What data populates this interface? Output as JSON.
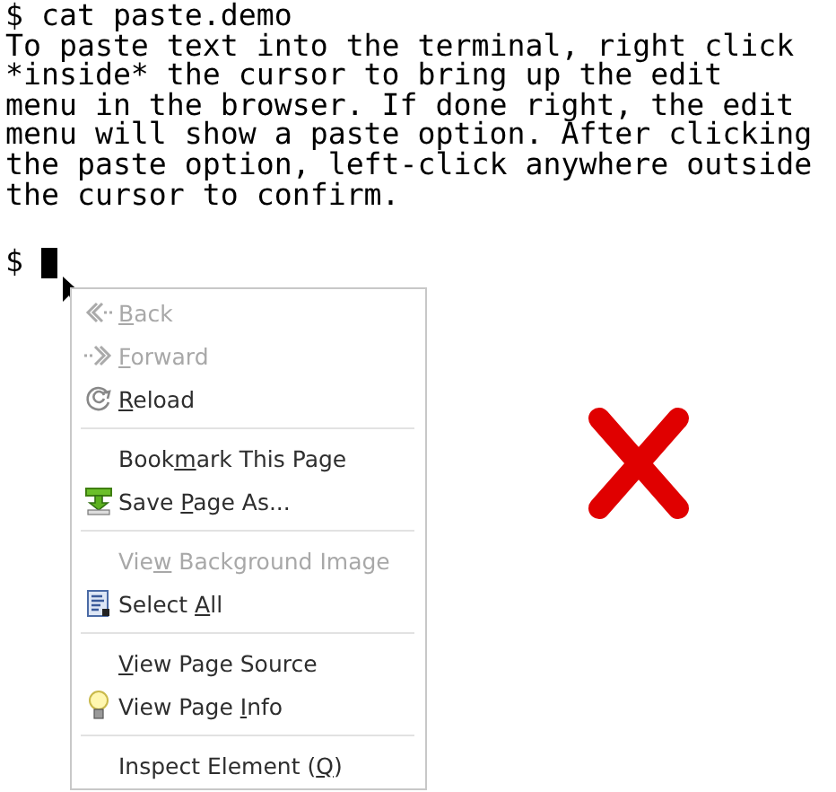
{
  "terminal": {
    "lines": [
      "$ cat paste.demo",
      "To paste text into the terminal, right click",
      "*inside* the cursor to bring up the edit",
      "menu in the browser. If done right, the edit",
      "menu will show a paste option. After clicking",
      "the paste option, left-click anywhere outside",
      "the cursor to confirm."
    ],
    "prompt": "$"
  },
  "context_menu": {
    "items": [
      {
        "kind": "item",
        "key": "B",
        "post": "ack",
        "disabled": true
      },
      {
        "kind": "item",
        "key": "F",
        "post": "orward",
        "disabled": true
      },
      {
        "kind": "item",
        "key": "R",
        "post": "eload",
        "disabled": false
      },
      {
        "kind": "separator"
      },
      {
        "kind": "item",
        "pre": "Book",
        "key": "m",
        "post": "ark This Page",
        "disabled": false
      },
      {
        "kind": "item",
        "pre": "Save ",
        "key": "P",
        "post": "age As...",
        "disabled": false
      },
      {
        "kind": "separator"
      },
      {
        "kind": "item",
        "pre": "Vie",
        "key": "w",
        "post": " Background Image",
        "disabled": true
      },
      {
        "kind": "item",
        "pre": "Select ",
        "key": "A",
        "post": "ll",
        "disabled": false
      },
      {
        "kind": "separator"
      },
      {
        "kind": "item",
        "key": "V",
        "post": "iew Page Source",
        "disabled": false
      },
      {
        "kind": "item",
        "pre": "View Page ",
        "key": "I",
        "post": "nfo",
        "disabled": false
      },
      {
        "kind": "separator"
      },
      {
        "kind": "item",
        "pre": "Inspect Element (",
        "key": "Q",
        "post": ")",
        "disabled": false
      }
    ]
  }
}
